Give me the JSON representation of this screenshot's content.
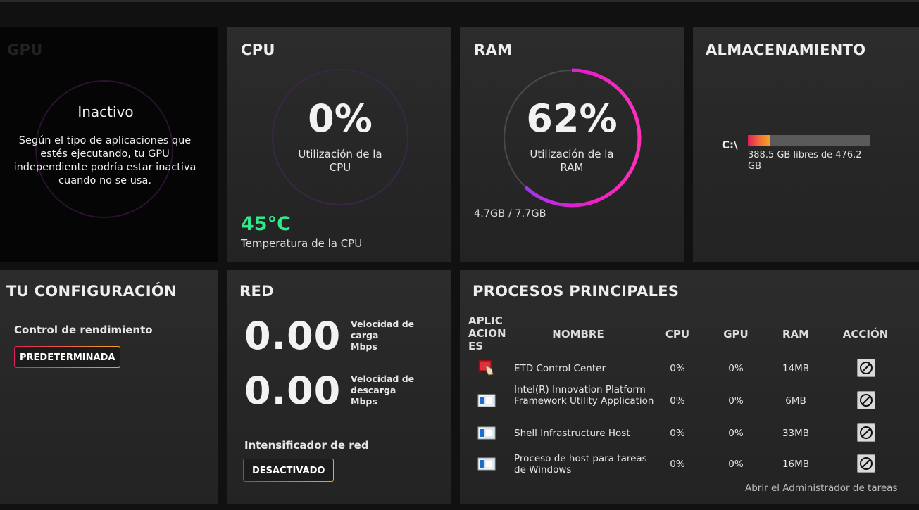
{
  "gpu": {
    "title": "GPU",
    "state": "Inactivo",
    "description": "Según el tipo de aplicaciones que estés ejecutando, tu GPU independiente podría estar inactiva cuando no se usa."
  },
  "cpu": {
    "title": "CPU",
    "percent": 0,
    "percent_label": "0%",
    "util_label": "Utilización de la CPU",
    "temperature": "45°C",
    "temperature_label": "Temperatura de la CPU"
  },
  "ram": {
    "title": "RAM",
    "percent": 62,
    "percent_label": "62%",
    "util_label": "Utilización de la RAM",
    "usage": "4.7GB / 7.7GB"
  },
  "storage": {
    "title": "ALMACENAMIENTO",
    "drive": "C:\\",
    "used_fraction": 0.184,
    "free_text": "388.5 GB libres de 476.2 GB"
  },
  "config": {
    "title": "TU CONFIGURACIÓN",
    "performance_label": "Control de rendimiento",
    "performance_value": "PREDETERMINADA"
  },
  "network": {
    "title": "RED",
    "upload_value": "0.00",
    "upload_label": "Velocidad de carga",
    "upload_unit": "Mbps",
    "download_value": "0.00",
    "download_label": "Velocidad de descarga",
    "download_unit": "Mbps",
    "booster_label": "Intensificador de red",
    "booster_value": "DESACTIVADO"
  },
  "processes": {
    "title": "PROCESOS PRINCIPALES",
    "headers": {
      "apps": "APLIC\nACION\nES",
      "name": "NOMBRE",
      "cpu": "CPU",
      "gpu": "GPU",
      "ram": "RAM",
      "action": "ACCIÓN"
    },
    "rows": [
      {
        "icon": "etd-control-center-icon",
        "name": "ETD Control Center",
        "cpu": "0%",
        "gpu": "0%",
        "ram": "14MB"
      },
      {
        "icon": "window-app-icon",
        "name": "Intel(R) Innovation Platform Framework Utility Application",
        "cpu": "0%",
        "gpu": "0%",
        "ram": "6MB"
      },
      {
        "icon": "window-app-icon",
        "name": "Shell Infrastructure Host",
        "cpu": "0%",
        "gpu": "0%",
        "ram": "33MB"
      },
      {
        "icon": "window-app-icon",
        "name": "Proceso de host para tareas de Windows",
        "cpu": "0%",
        "gpu": "0%",
        "ram": "16MB"
      }
    ],
    "task_manager_link": "Abrir el Administrador de tareas"
  },
  "colors": {
    "accent_magenta": "#e81fc8",
    "accent_purple": "#8a3cff",
    "temperature_green": "#2ee88a",
    "gradient_start": "#e0205a",
    "gradient_end": "#f5a623"
  }
}
